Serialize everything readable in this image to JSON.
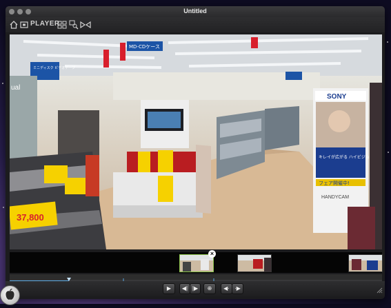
{
  "window": {
    "title": "Untitled"
  },
  "toolbar": {
    "player_label": "PLAYER",
    "icons": [
      "home-icon",
      "film-icon",
      "grid-icon",
      "magnify-tool-icon",
      "bowtie-icon"
    ]
  },
  "video": {
    "signs": {
      "left_banner": "ミニディスク ビデオテープ",
      "center_banner": "MD-CDケース",
      "right_brand": "SONY",
      "right_headline": "キレイが広がる ハイビジョン \"ハンディカム\"",
      "right_sub": "フェア開催中!",
      "right_logo": "HANDYCAM",
      "price_big": "37,800",
      "left_small": "ual"
    }
  },
  "filmstrip": {
    "thumbnails": [
      "thumbnail-1",
      "thumbnail-2",
      "thumbnail-3"
    ],
    "close_glyph": "×"
  },
  "controls": {
    "play": "▶",
    "step_back": "◀|",
    "step_fwd": "|▶",
    "target": "⊕",
    "nav_left": "◀·",
    "nav_right": "·▶"
  },
  "colors": {
    "chrome_dark": "#1c1c1e",
    "thumb_selected_border": "#8bc34a",
    "price_tag": "#f6d100",
    "sony_banner": "#1b3d8f"
  }
}
